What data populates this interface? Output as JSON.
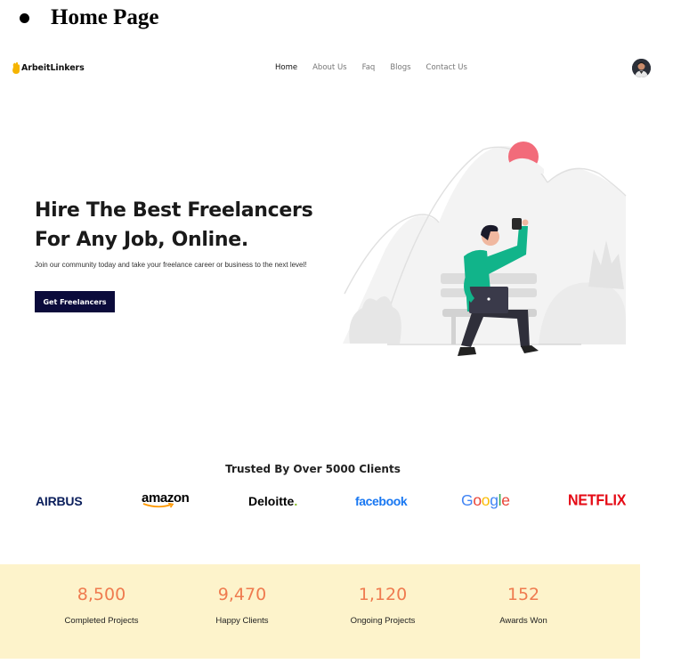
{
  "doc": {
    "heading": "Home Page"
  },
  "nav": {
    "brand": "ArbeitLinkers",
    "links": [
      "Home",
      "About Us",
      "Faq",
      "Blogs",
      "Contact Us"
    ],
    "active": "Home"
  },
  "hero": {
    "title_line1": "Hire The Best Freelancers",
    "title_line2": "For Any Job, Online.",
    "subtitle": "Join our community today and take your freelance career or business to the next level!",
    "cta": "Get Freelancers"
  },
  "trusted": {
    "title": "Trusted By Over 5000 Clients",
    "brands": [
      "AIRBUS",
      "amazon",
      "Deloitte",
      "facebook",
      "Google",
      "NETFLIX"
    ]
  },
  "stats": [
    {
      "value": "8,500",
      "label": "Completed Projects"
    },
    {
      "value": "9,470",
      "label": "Happy Clients"
    },
    {
      "value": "1,120",
      "label": "Ongoing Projects"
    },
    {
      "value": "152",
      "label": "Awards Won"
    }
  ],
  "colors": {
    "cta_bg": "#0b0b3b",
    "stats_band": "#fdf3cb",
    "stat_value": "#ef7b4f",
    "shirt": "#11b48a",
    "sun": "#f26b7a",
    "logo_mark": "#f5b400"
  },
  "icons": {
    "logo": "hand-logo-icon",
    "avatar": "user-avatar"
  }
}
